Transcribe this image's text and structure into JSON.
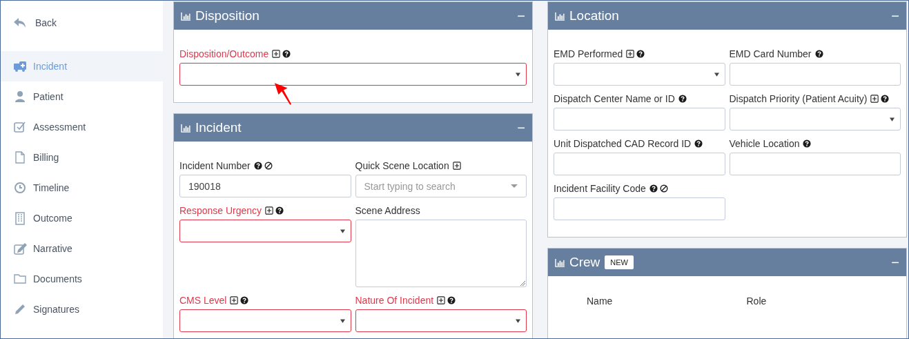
{
  "sidebar": {
    "back": "Back",
    "items": [
      {
        "label": "Incident",
        "selected": true
      },
      {
        "label": "Patient",
        "selected": false
      },
      {
        "label": "Assessment",
        "selected": false
      },
      {
        "label": "Billing",
        "selected": false
      },
      {
        "label": "Timeline",
        "selected": false
      },
      {
        "label": "Outcome",
        "selected": false
      },
      {
        "label": "Narrative",
        "selected": false
      },
      {
        "label": "Documents",
        "selected": false
      },
      {
        "label": "Signatures",
        "selected": false
      }
    ]
  },
  "left_panels": [
    {
      "title": "Disposition",
      "collapse": "−",
      "fields": [
        {
          "label": "Disposition/Outcome",
          "required": true,
          "plus": true,
          "help": true,
          "ban": false,
          "kind": "select"
        }
      ]
    },
    {
      "title": "Incident",
      "collapse": "−",
      "fields": [
        {
          "label": "Incident Number",
          "required": false,
          "plus": false,
          "help": true,
          "ban": true,
          "kind": "input",
          "value": "190018"
        },
        {
          "label": "Quick Scene Location",
          "required": false,
          "plus": true,
          "help": false,
          "ban": false,
          "kind": "typeahead",
          "placeholder": "Start typing to search"
        },
        {
          "label": "Response Urgency",
          "required": true,
          "plus": true,
          "help": true,
          "ban": false,
          "kind": "select"
        },
        {
          "label": "Scene Address",
          "required": false,
          "plus": false,
          "help": false,
          "ban": false,
          "kind": "textarea"
        },
        {
          "label": "CMS Level",
          "required": true,
          "plus": true,
          "help": true,
          "ban": false,
          "kind": "select"
        },
        {
          "label": "Nature Of Incident",
          "required": true,
          "plus": true,
          "help": true,
          "ban": false,
          "kind": "select"
        }
      ]
    }
  ],
  "right_panels": [
    {
      "title": "Location",
      "collapse": "−",
      "fields": [
        {
          "label": "EMD Performed",
          "required": false,
          "plus": true,
          "help": true,
          "ban": false,
          "kind": "select"
        },
        {
          "label": "EMD Card Number",
          "required": false,
          "plus": false,
          "help": true,
          "ban": false,
          "kind": "input"
        },
        {
          "label": "Dispatch Center Name or ID",
          "required": false,
          "plus": false,
          "help": true,
          "ban": false,
          "kind": "input"
        },
        {
          "label": "Dispatch Priority (Patient Acuity)",
          "required": false,
          "plus": true,
          "help": true,
          "ban": false,
          "kind": "select"
        },
        {
          "label": "Unit Dispatched CAD Record ID",
          "required": false,
          "plus": false,
          "help": true,
          "ban": false,
          "kind": "input"
        },
        {
          "label": "Vehicle Location",
          "required": false,
          "plus": false,
          "help": true,
          "ban": false,
          "kind": "input"
        },
        {
          "label": "Incident Facility Code",
          "required": false,
          "plus": false,
          "help": true,
          "ban": true,
          "kind": "input"
        }
      ]
    },
    {
      "title": "Crew",
      "collapse": "−",
      "badge": "NEW",
      "columns": [
        "Name",
        "Role"
      ]
    }
  ]
}
